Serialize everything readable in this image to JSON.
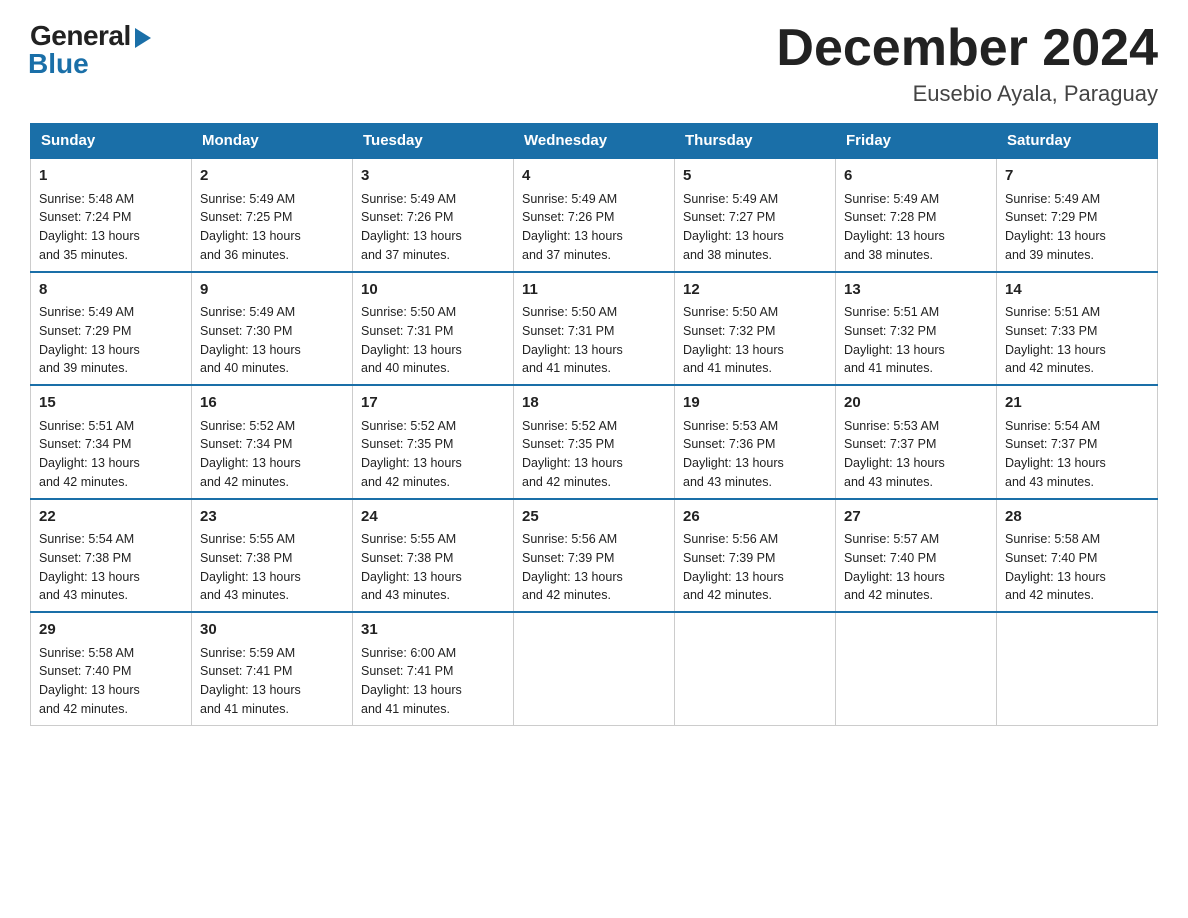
{
  "header": {
    "logo_general": "General",
    "logo_blue": "Blue",
    "month_title": "December 2024",
    "location": "Eusebio Ayala, Paraguay"
  },
  "days_of_week": [
    "Sunday",
    "Monday",
    "Tuesday",
    "Wednesday",
    "Thursday",
    "Friday",
    "Saturday"
  ],
  "weeks": [
    [
      {
        "day": "1",
        "sunrise": "5:48 AM",
        "sunset": "7:24 PM",
        "daylight": "13 hours and 35 minutes."
      },
      {
        "day": "2",
        "sunrise": "5:49 AM",
        "sunset": "7:25 PM",
        "daylight": "13 hours and 36 minutes."
      },
      {
        "day": "3",
        "sunrise": "5:49 AM",
        "sunset": "7:26 PM",
        "daylight": "13 hours and 37 minutes."
      },
      {
        "day": "4",
        "sunrise": "5:49 AM",
        "sunset": "7:26 PM",
        "daylight": "13 hours and 37 minutes."
      },
      {
        "day": "5",
        "sunrise": "5:49 AM",
        "sunset": "7:27 PM",
        "daylight": "13 hours and 38 minutes."
      },
      {
        "day": "6",
        "sunrise": "5:49 AM",
        "sunset": "7:28 PM",
        "daylight": "13 hours and 38 minutes."
      },
      {
        "day": "7",
        "sunrise": "5:49 AM",
        "sunset": "7:29 PM",
        "daylight": "13 hours and 39 minutes."
      }
    ],
    [
      {
        "day": "8",
        "sunrise": "5:49 AM",
        "sunset": "7:29 PM",
        "daylight": "13 hours and 39 minutes."
      },
      {
        "day": "9",
        "sunrise": "5:49 AM",
        "sunset": "7:30 PM",
        "daylight": "13 hours and 40 minutes."
      },
      {
        "day": "10",
        "sunrise": "5:50 AM",
        "sunset": "7:31 PM",
        "daylight": "13 hours and 40 minutes."
      },
      {
        "day": "11",
        "sunrise": "5:50 AM",
        "sunset": "7:31 PM",
        "daylight": "13 hours and 41 minutes."
      },
      {
        "day": "12",
        "sunrise": "5:50 AM",
        "sunset": "7:32 PM",
        "daylight": "13 hours and 41 minutes."
      },
      {
        "day": "13",
        "sunrise": "5:51 AM",
        "sunset": "7:32 PM",
        "daylight": "13 hours and 41 minutes."
      },
      {
        "day": "14",
        "sunrise": "5:51 AM",
        "sunset": "7:33 PM",
        "daylight": "13 hours and 42 minutes."
      }
    ],
    [
      {
        "day": "15",
        "sunrise": "5:51 AM",
        "sunset": "7:34 PM",
        "daylight": "13 hours and 42 minutes."
      },
      {
        "day": "16",
        "sunrise": "5:52 AM",
        "sunset": "7:34 PM",
        "daylight": "13 hours and 42 minutes."
      },
      {
        "day": "17",
        "sunrise": "5:52 AM",
        "sunset": "7:35 PM",
        "daylight": "13 hours and 42 minutes."
      },
      {
        "day": "18",
        "sunrise": "5:52 AM",
        "sunset": "7:35 PM",
        "daylight": "13 hours and 42 minutes."
      },
      {
        "day": "19",
        "sunrise": "5:53 AM",
        "sunset": "7:36 PM",
        "daylight": "13 hours and 43 minutes."
      },
      {
        "day": "20",
        "sunrise": "5:53 AM",
        "sunset": "7:37 PM",
        "daylight": "13 hours and 43 minutes."
      },
      {
        "day": "21",
        "sunrise": "5:54 AM",
        "sunset": "7:37 PM",
        "daylight": "13 hours and 43 minutes."
      }
    ],
    [
      {
        "day": "22",
        "sunrise": "5:54 AM",
        "sunset": "7:38 PM",
        "daylight": "13 hours and 43 minutes."
      },
      {
        "day": "23",
        "sunrise": "5:55 AM",
        "sunset": "7:38 PM",
        "daylight": "13 hours and 43 minutes."
      },
      {
        "day": "24",
        "sunrise": "5:55 AM",
        "sunset": "7:38 PM",
        "daylight": "13 hours and 43 minutes."
      },
      {
        "day": "25",
        "sunrise": "5:56 AM",
        "sunset": "7:39 PM",
        "daylight": "13 hours and 42 minutes."
      },
      {
        "day": "26",
        "sunrise": "5:56 AM",
        "sunset": "7:39 PM",
        "daylight": "13 hours and 42 minutes."
      },
      {
        "day": "27",
        "sunrise": "5:57 AM",
        "sunset": "7:40 PM",
        "daylight": "13 hours and 42 minutes."
      },
      {
        "day": "28",
        "sunrise": "5:58 AM",
        "sunset": "7:40 PM",
        "daylight": "13 hours and 42 minutes."
      }
    ],
    [
      {
        "day": "29",
        "sunrise": "5:58 AM",
        "sunset": "7:40 PM",
        "daylight": "13 hours and 42 minutes."
      },
      {
        "day": "30",
        "sunrise": "5:59 AM",
        "sunset": "7:41 PM",
        "daylight": "13 hours and 41 minutes."
      },
      {
        "day": "31",
        "sunrise": "6:00 AM",
        "sunset": "7:41 PM",
        "daylight": "13 hours and 41 minutes."
      },
      null,
      null,
      null,
      null
    ]
  ],
  "labels": {
    "sunrise": "Sunrise:",
    "sunset": "Sunset:",
    "daylight": "Daylight:"
  }
}
